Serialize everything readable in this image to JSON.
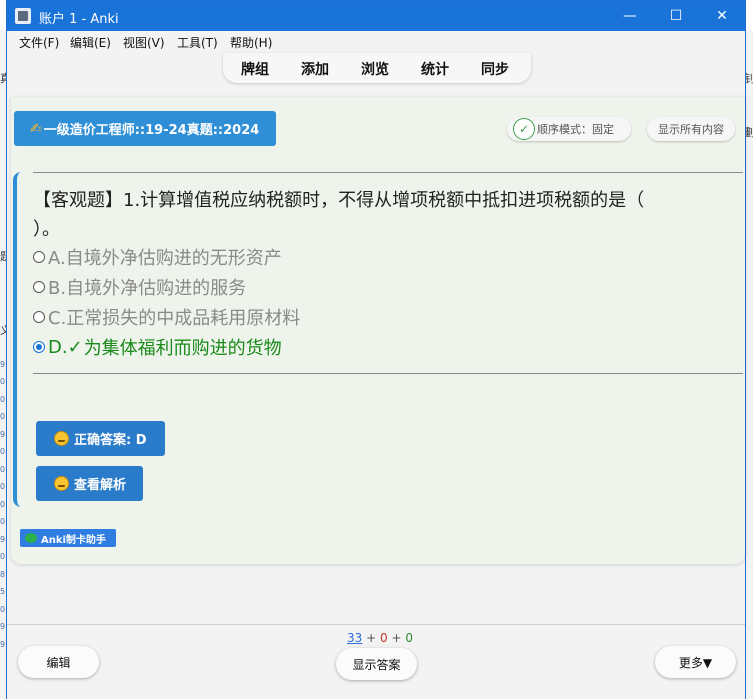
{
  "window": {
    "title": "账户 1 - Anki",
    "minimize_icon": "—",
    "maximize_icon": "☐",
    "close_icon": "✕"
  },
  "background": {
    "left_glyphs": [
      "真",
      "题",
      "义"
    ],
    "right_glyphs": [
      "钊",
      "劃"
    ],
    "left_numbers": [
      "9",
      "0",
      "0",
      "0",
      "9",
      "0",
      "0",
      "0",
      "0",
      "0",
      "9",
      "0",
      "8",
      "5",
      "0",
      "9",
      "9"
    ]
  },
  "menu": [
    "文件(F)",
    "编辑(E)",
    "视图(V)",
    "工具(T)",
    "帮助(H)"
  ],
  "toolbar": [
    "牌组",
    "添加",
    "浏览",
    "统计",
    "同步"
  ],
  "card": {
    "deck_icon": "✍",
    "deck_name": "一级造价工程师::19-24真题::2024",
    "mode_check": "✓",
    "mode_label": "顺序模式：固定",
    "show_all_label": "显示所有内容",
    "question_line1": "【客观题】1.计算增值税应纳税额时，不得从增项税额中抵扣进项税额的是（",
    "question_line2": "）。",
    "options": [
      {
        "label": "A.自境外净估购进的无形资产",
        "selected": false,
        "correct": false
      },
      {
        "label": "B.自境外净估购进的服务",
        "selected": false,
        "correct": false
      },
      {
        "label": "C.正常损失的中成品耗用原材料",
        "selected": false,
        "correct": false
      },
      {
        "label": "D.",
        "tick": "✓",
        "rest": "为集体福利而购进的货物",
        "selected": true,
        "correct": true
      }
    ],
    "answer_button": "正确答案: D",
    "explain_button": "查看解析",
    "helper_badge": "Anki制卡助手"
  },
  "bottom": {
    "count_new": "33",
    "count_learn": "0",
    "count_review": "0",
    "plus": "+",
    "edit_button": "编辑",
    "show_answer_button": "显示答案",
    "more_button": "更多▼"
  },
  "colors": {
    "titlebar": "#1a73d9",
    "accent_blue": "#2f8fd6",
    "correct_green": "#1a8a1a",
    "card_bg": "#eef4ec"
  }
}
